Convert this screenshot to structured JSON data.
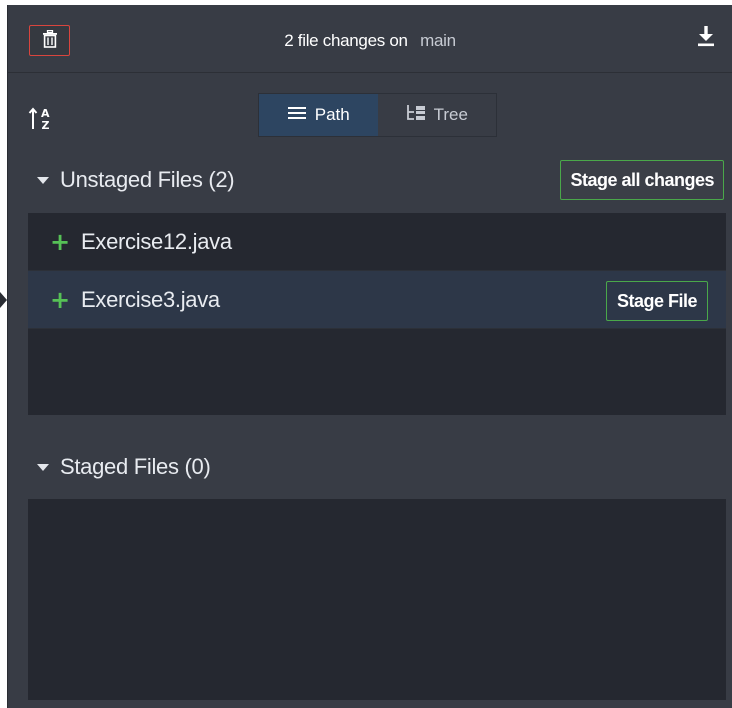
{
  "header": {
    "title_prefix": "2 file changes on",
    "branch": "main",
    "trash_icon": "trash-icon",
    "download_icon": "download-icon",
    "accent_danger": "#d9453e"
  },
  "toolbar": {
    "sort_icon": "sort-alpha-icon",
    "view_options": [
      {
        "label": "Path",
        "icon": "list-icon",
        "active": true
      },
      {
        "label": "Tree",
        "icon": "tree-icon",
        "active": false
      }
    ]
  },
  "unstaged": {
    "label": "Unstaged Files (2)",
    "stage_all_label": "Stage all changes",
    "files": [
      {
        "name": "Exercise12.java",
        "status": "+"
      },
      {
        "name": "Exercise3.java",
        "status": "+",
        "selected": true,
        "action_label": "Stage File"
      }
    ]
  },
  "staged": {
    "label": "Staged Files (0)",
    "files": []
  },
  "colors": {
    "panel_bg": "#383c45",
    "list_bg": "#252830",
    "selected_row": "#2d3748",
    "added_green": "#56c156",
    "button_border_green": "#4aa84a"
  }
}
